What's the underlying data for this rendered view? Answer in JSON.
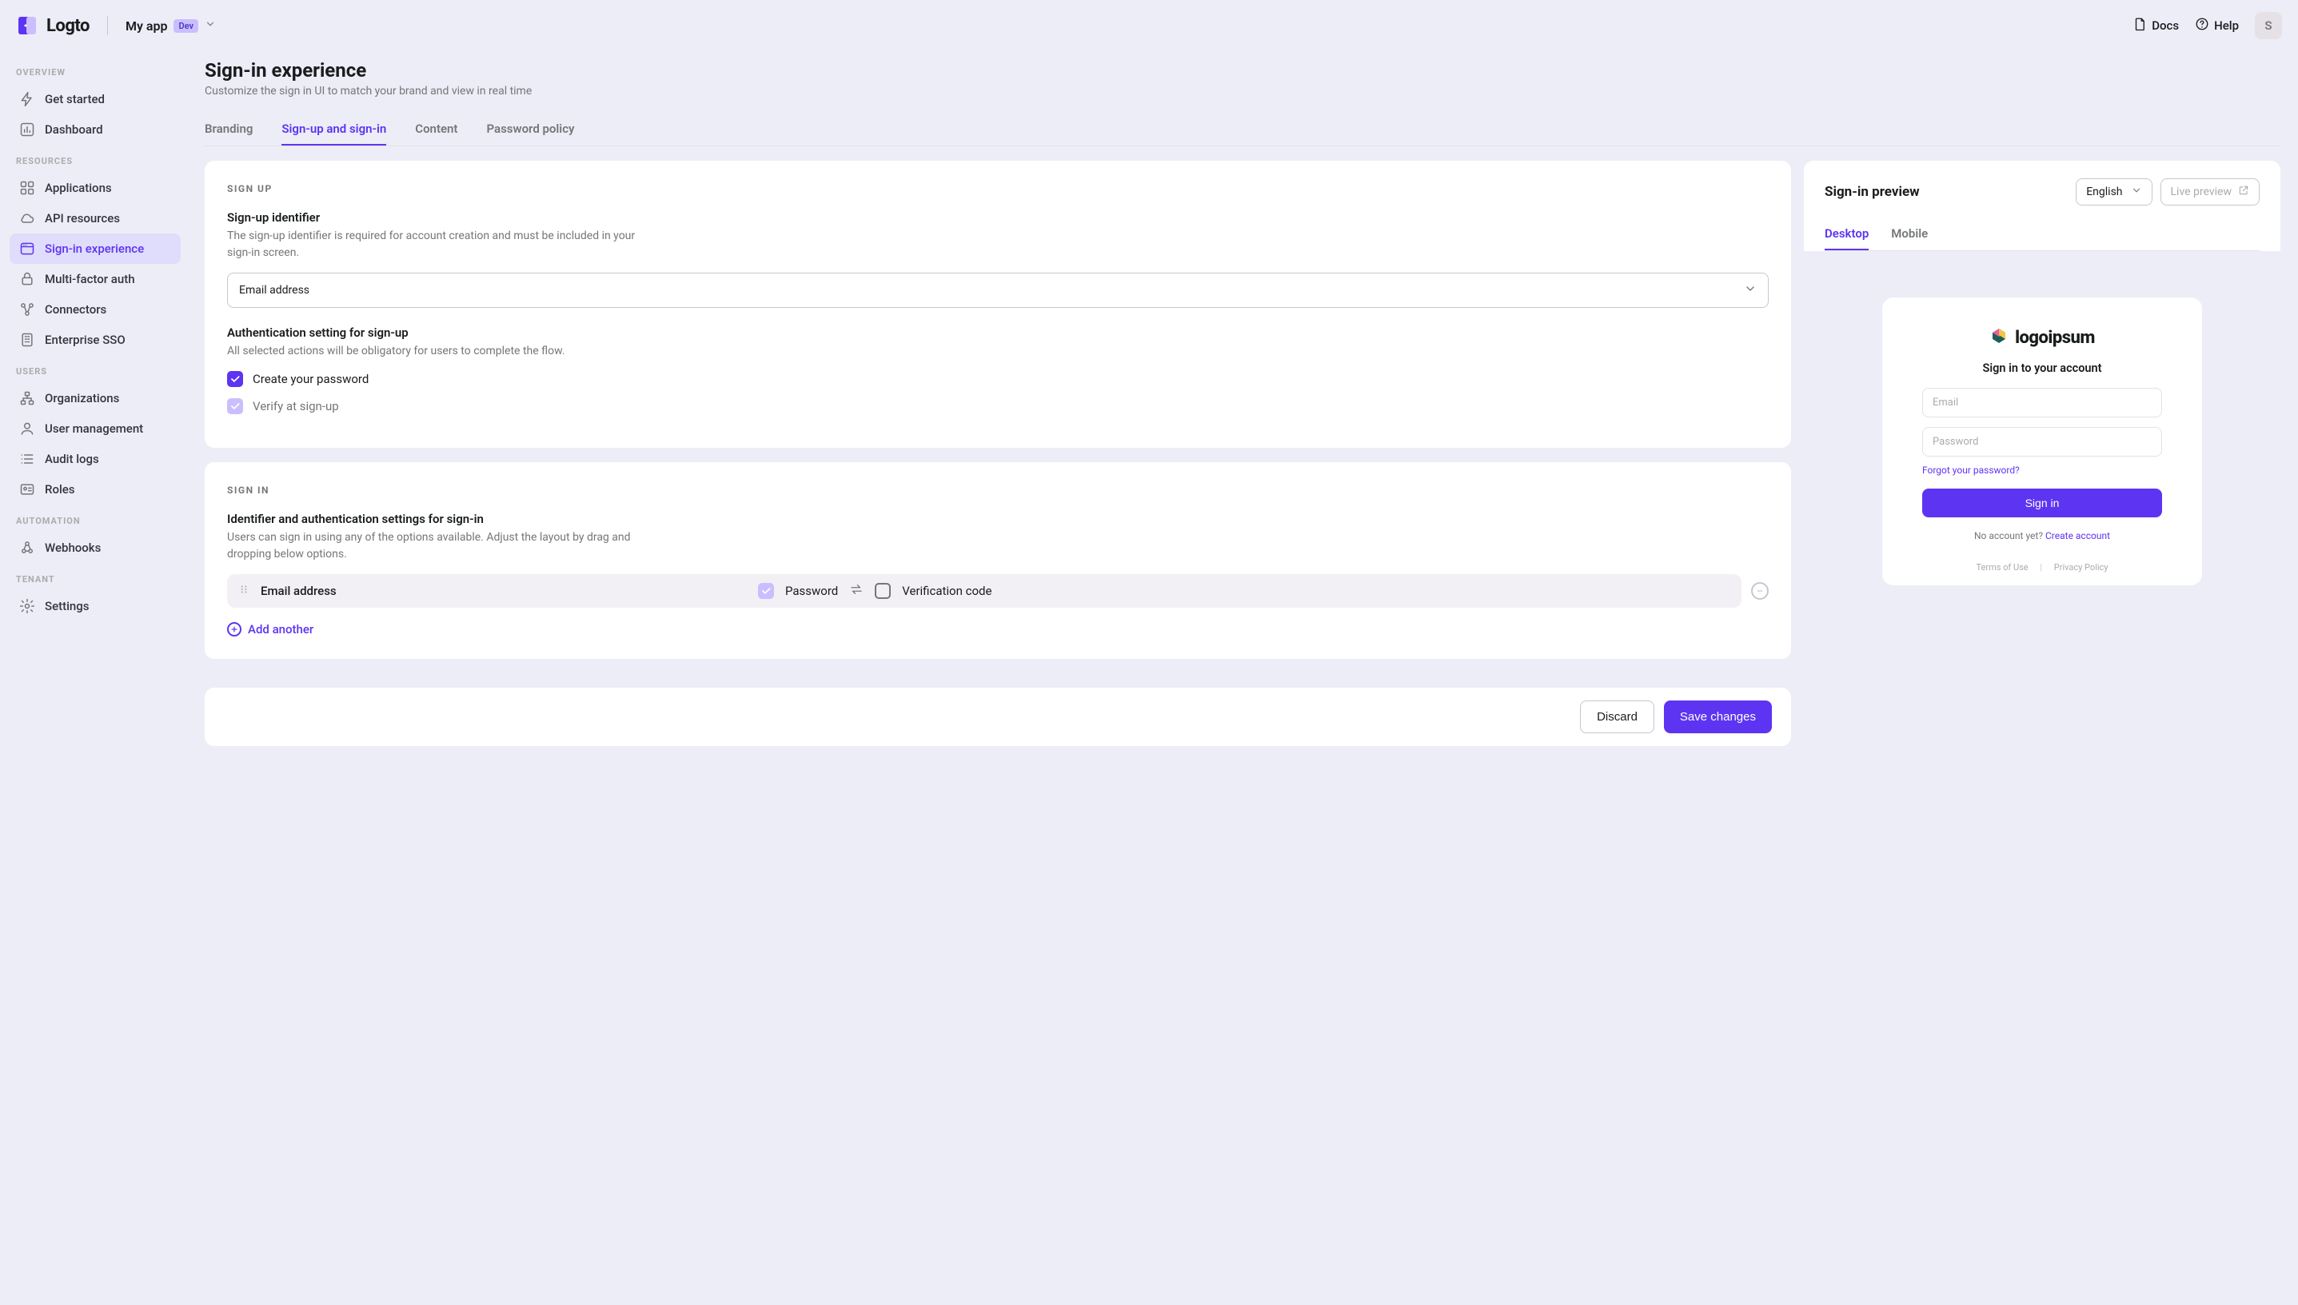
{
  "brand": "Logto",
  "header": {
    "app_name": "My app",
    "env_badge": "Dev",
    "docs": "Docs",
    "help": "Help",
    "avatar_initial": "S"
  },
  "sidebar": {
    "sections": [
      {
        "label": "OVERVIEW",
        "items": [
          {
            "label": "Get started"
          },
          {
            "label": "Dashboard"
          }
        ]
      },
      {
        "label": "RESOURCES",
        "items": [
          {
            "label": "Applications"
          },
          {
            "label": "API resources"
          },
          {
            "label": "Sign-in experience",
            "active": true
          },
          {
            "label": "Multi-factor auth"
          },
          {
            "label": "Connectors"
          },
          {
            "label": "Enterprise SSO"
          }
        ]
      },
      {
        "label": "USERS",
        "items": [
          {
            "label": "Organizations"
          },
          {
            "label": "User management"
          },
          {
            "label": "Audit logs"
          },
          {
            "label": "Roles"
          }
        ]
      },
      {
        "label": "AUTOMATION",
        "items": [
          {
            "label": "Webhooks"
          }
        ]
      },
      {
        "label": "TENANT",
        "items": [
          {
            "label": "Settings"
          }
        ]
      }
    ]
  },
  "page": {
    "title": "Sign-in experience",
    "subtitle": "Customize the sign in UI to match your brand and view in real time"
  },
  "tabs": [
    {
      "label": "Branding"
    },
    {
      "label": "Sign-up and sign-in",
      "active": true
    },
    {
      "label": "Content"
    },
    {
      "label": "Password policy"
    }
  ],
  "signup": {
    "caption": "SIGN UP",
    "identifier_title": "Sign-up identifier",
    "identifier_desc": "The sign-up identifier is required for account creation and must be included in your sign-in screen.",
    "identifier_value": "Email address",
    "auth_title": "Authentication setting for sign-up",
    "auth_desc": "All selected actions will be obligatory for users to complete the flow.",
    "create_password_label": "Create your password",
    "verify_signup_label": "Verify at sign-up"
  },
  "signin": {
    "caption": "SIGN IN",
    "identifier_title": "Identifier and authentication settings for sign-in",
    "identifier_desc": "Users can sign in using any of the options available. Adjust the layout by drag and dropping below options.",
    "row_identifier": "Email address",
    "password_label": "Password",
    "verification_label": "Verification code",
    "add_another": "Add another"
  },
  "preview": {
    "title": "Sign-in preview",
    "lang": "English",
    "live_preview": "Live preview",
    "tabs": [
      {
        "label": "Desktop",
        "active": true
      },
      {
        "label": "Mobile"
      }
    ],
    "logo_text": "logoipsum",
    "heading": "Sign in to your account",
    "email_placeholder": "Email",
    "password_placeholder": "Password",
    "forgot": "Forgot your password?",
    "signin_btn": "Sign in",
    "no_account_pre": "No account yet? ",
    "create_account": "Create account",
    "terms": "Terms of Use",
    "privacy": "Privacy Policy"
  },
  "footer": {
    "discard": "Discard",
    "save": "Save changes"
  }
}
